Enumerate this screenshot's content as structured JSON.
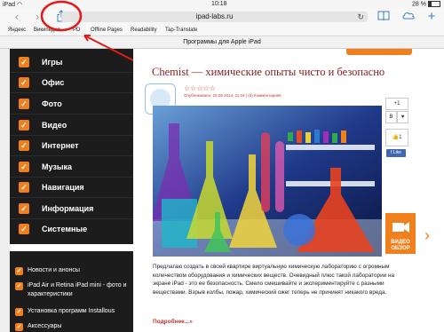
{
  "statusbar": {
    "device": "iPad",
    "wifi": "◠",
    "time": "10:18",
    "battery": "28 %"
  },
  "toolbar": {
    "back": "‹",
    "forward": "›",
    "url": "ipad-labs.ru",
    "reload": "↻"
  },
  "bookmarks": [
    "Яндекс",
    "Википедия",
    "PD",
    "Offline Pages",
    "Readability",
    "Tap-Translate"
  ],
  "tab_title": "Программы для Apple iPad",
  "sidebar": {
    "items": [
      {
        "label": "Игры"
      },
      {
        "label": "Офис"
      },
      {
        "label": "Фото"
      },
      {
        "label": "Видео"
      },
      {
        "label": "Интернет"
      },
      {
        "label": "Музыка"
      },
      {
        "label": "Навигация"
      },
      {
        "label": "Информация"
      },
      {
        "label": "Системные"
      }
    ],
    "news": [
      {
        "label": "Новости и анонсы"
      },
      {
        "label": "iPad Air и Retina iPad mini - фото и характеристики"
      },
      {
        "label": "Установка программ Installous"
      },
      {
        "label": "Аксессуары"
      }
    ]
  },
  "article": {
    "title": "Chemist — химические опыты чисто и безопасно",
    "stars": "☆☆☆☆☆",
    "meta": "Опубликовано: 25.08.2014, 11:19 | (0) Комментариев",
    "text": "Предлагаю создать в своей квартире виртуальную химическую лабораторию с огромным количеством оборудования и химических веществ. Очевидный плюс такой лаборатории на экране iPad - это ее безопасность. Смело смешивайте и экспериментируйте с разными веществами. Взрыв колбы, пожар, химический ожег теперь не причинят никакого вреда.",
    "readmore": "Подробнее...»"
  },
  "social": {
    "gplus": "+1",
    "vk": "В",
    "like_count": "1",
    "fb_like": "f Like"
  },
  "video_badge": "ВИДЕО ОБЗОР",
  "colors": {
    "accent": "#f07f1e",
    "sidebar": "#1c1c1c",
    "title": "#8a1b1b",
    "annotation": "#e01b1b"
  }
}
